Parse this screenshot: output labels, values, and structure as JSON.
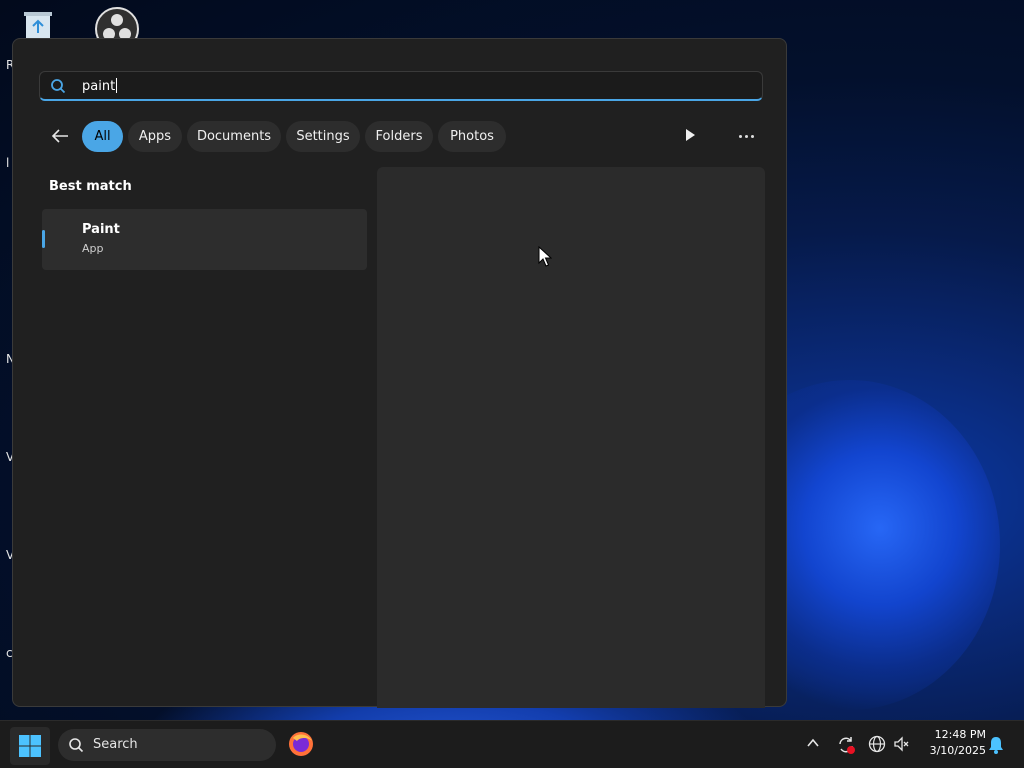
{
  "desktop": {
    "edge_letters": [
      "R",
      "l",
      "N",
      "V",
      "V",
      "c"
    ]
  },
  "search": {
    "query": "paint",
    "search_icon": "search-icon"
  },
  "filters": {
    "back_icon": "back-arrow-icon",
    "chips": [
      "All",
      "Apps",
      "Documents",
      "Settings",
      "Folders",
      "Photos"
    ],
    "active": "All",
    "play_icon": "play-icon",
    "more_icon": "more-options-icon"
  },
  "results": {
    "section_title": "Best match",
    "best_match": {
      "name": "Paint",
      "type": "App"
    }
  },
  "taskbar": {
    "start_icon": "windows-start-icon",
    "search_placeholder": "Search",
    "pinned": [
      "firefox-icon"
    ],
    "tray_icons": [
      "chevron-up-icon",
      "sync-alert-icon",
      "network-globe-icon",
      "volume-muted-icon"
    ],
    "time": "12:48 PM",
    "date": "3/10/2025",
    "notification_icon": "bell-icon"
  },
  "colors": {
    "accent": "#4aa6e6",
    "panel_bg": "#202020",
    "preview_bg": "#2b2b2b",
    "chip_bg": "#2d2d2d",
    "taskbar_bg": "#1c1c1c"
  }
}
